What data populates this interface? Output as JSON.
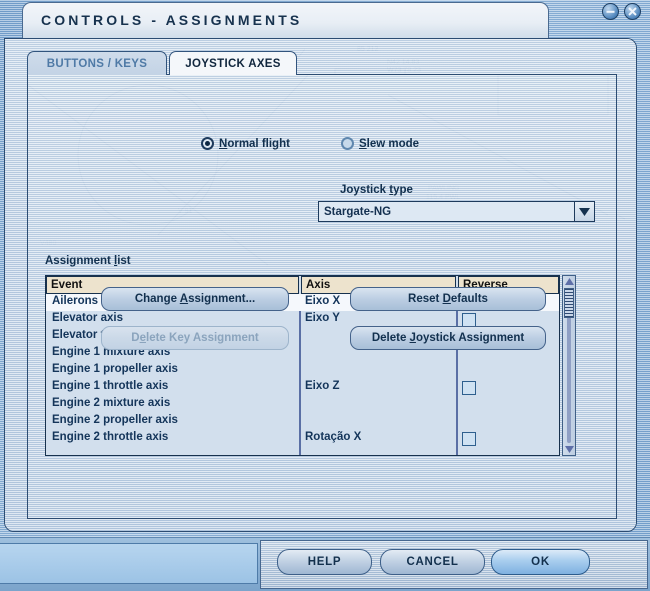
{
  "window": {
    "title": "CONTROLS - ASSIGNMENTS",
    "minimize_icon": "minimize-icon",
    "close_icon": "close-icon"
  },
  "tabs": [
    {
      "label": "BUTTONS / KEYS",
      "active": false
    },
    {
      "label": "JOYSTICK AXES",
      "active": true
    }
  ],
  "mode": {
    "options": [
      {
        "label": "Normal flight",
        "accel": "N",
        "selected": true
      },
      {
        "label": "Slew mode",
        "accel": "S",
        "selected": false
      }
    ]
  },
  "joystick_type": {
    "label": "Joystick type",
    "accel": "t",
    "value": "Stargate-NG",
    "arrow_icon": "chevron-down-icon"
  },
  "assignment_list": {
    "label": "Assignment list",
    "accel": "l",
    "columns": [
      "Event",
      "Axis",
      "Reverse"
    ],
    "rows": [
      {
        "event": "Ailerons axis",
        "axis": "Eixo X",
        "reverse": true,
        "selected": true
      },
      {
        "event": "Elevator axis",
        "axis": "Eixo Y",
        "reverse": true,
        "selected": false
      },
      {
        "event": "Elevator trim axis",
        "axis": "",
        "reverse": false,
        "selected": false
      },
      {
        "event": "Engine 1 mixture axis",
        "axis": "",
        "reverse": false,
        "selected": false
      },
      {
        "event": "Engine 1 propeller axis",
        "axis": "",
        "reverse": false,
        "selected": false
      },
      {
        "event": "Engine 1 throttle axis",
        "axis": "Eixo Z",
        "reverse": true,
        "selected": false
      },
      {
        "event": "Engine 2 mixture axis",
        "axis": "",
        "reverse": false,
        "selected": false
      },
      {
        "event": "Engine 2 propeller axis",
        "axis": "",
        "reverse": false,
        "selected": false
      },
      {
        "event": "Engine 2 throttle axis",
        "axis": "Rotação X",
        "reverse": true,
        "selected": false
      }
    ],
    "scrollbar": {
      "up_icon": "scroll-up-arrow-icon",
      "down_icon": "scroll-down-arrow-icon"
    }
  },
  "actions": [
    {
      "name": "change-assignment",
      "label": "Change Assignment...",
      "accel": "A",
      "enabled": true
    },
    {
      "name": "reset-defaults",
      "label": "Reset Defaults",
      "accel": "D",
      "enabled": true
    },
    {
      "name": "delete-key",
      "label": "Delete Key Assignment",
      "accel": "e",
      "enabled": false
    },
    {
      "name": "delete-joystick",
      "label": "Delete Joystick Assignment",
      "accel": "J",
      "enabled": true
    }
  ],
  "footer": {
    "help_label": "HELP",
    "cancel_label": "CANCEL",
    "ok_label": "OK"
  },
  "colors": {
    "accent": "#2c4c72",
    "header_fill": "#ede3cd",
    "panel": "#c8d9ea",
    "text": "#12304e",
    "selected_row": "#f5f8fc"
  }
}
